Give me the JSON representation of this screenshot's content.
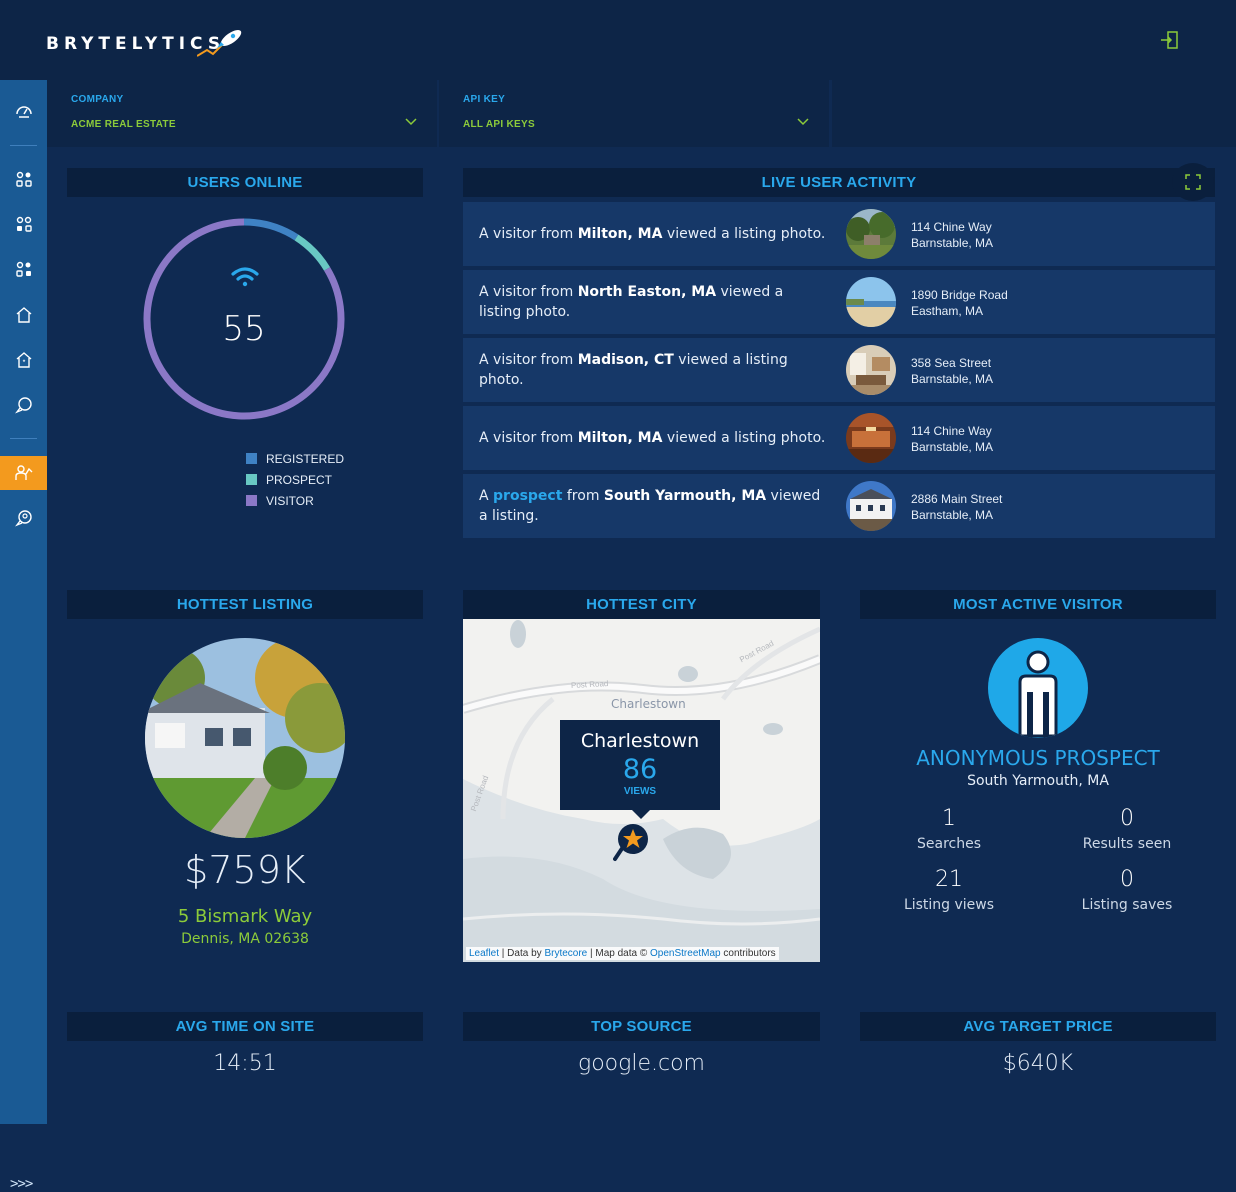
{
  "app": {
    "brand": "BRYTELYTICS"
  },
  "filters": {
    "company": {
      "label": "COMPANY",
      "value": "ACME REAL ESTATE"
    },
    "api_key": {
      "label": "API KEY",
      "value": "ALL API KEYS"
    }
  },
  "users_online": {
    "title": "USERS ONLINE",
    "count": "55",
    "legend": [
      {
        "label": "REGISTERED",
        "color": "#3f82c4"
      },
      {
        "label": "PROSPECT",
        "color": "#68c8c3"
      },
      {
        "label": "VISITOR",
        "color": "#8b78c7"
      }
    ],
    "breakdown": {
      "registered": 5,
      "prospect": 4,
      "visitor": 46
    }
  },
  "live_activity": {
    "title": "LIVE USER ACTIVITY",
    "rows": [
      {
        "pre": "A visitor from ",
        "place": "Milton, MA",
        "post": " viewed a listing photo.",
        "addr1": "114 Chine Way",
        "addr2": "Barnstable, MA"
      },
      {
        "pre": "A visitor from ",
        "place": "North Easton, MA",
        "post": " viewed a listing photo.",
        "addr1": "1890 Bridge Road",
        "addr2": "Eastham, MA"
      },
      {
        "pre": "A visitor from ",
        "place": "Madison, CT",
        "post": " viewed a listing photo.",
        "addr1": "358 Sea Street",
        "addr2": "Barnstable, MA"
      },
      {
        "pre": "A visitor from ",
        "place": "Milton, MA",
        "post": " viewed a listing photo.",
        "addr1": "114 Chine Way",
        "addr2": "Barnstable, MA"
      },
      {
        "pre": "A ",
        "role": "prospect",
        "mid": " from ",
        "place": "South Yarmouth, MA",
        "post": " viewed a listing.",
        "addr1": "2886 Main Street",
        "addr2": "Barnstable, MA"
      }
    ]
  },
  "hottest_listing": {
    "title": "HOTTEST LISTING",
    "price": "$759K",
    "street": "5 Bismark Way",
    "city": "Dennis, MA 02638"
  },
  "hottest_city": {
    "title": "HOTTEST CITY",
    "city": "Charlestown",
    "views": "86",
    "views_label": "VIEWS",
    "map_label": "Charlestown",
    "roads": [
      "Post Road",
      "Post Road",
      "Post Road"
    ],
    "attribution": {
      "leaflet": "Leaflet",
      "data_by": " | Data by ",
      "brytecore": "Brytecore",
      "map_data": " | Map data © ",
      "osm": "OpenStreetMap",
      "contrib": " contributors"
    }
  },
  "most_active_visitor": {
    "title": "MOST ACTIVE VISITOR",
    "name": "ANONYMOUS PROSPECT",
    "location": "South Yarmouth, MA",
    "stats": [
      {
        "value": "1",
        "label": "Searches"
      },
      {
        "value": "0",
        "label": "Results seen"
      },
      {
        "value": "21",
        "label": "Listing views"
      },
      {
        "value": "0",
        "label": "Listing saves"
      }
    ]
  },
  "kpis": [
    {
      "title": "AVG TIME ON SITE",
      "value": "14:51"
    },
    {
      "title": "TOP SOURCE",
      "value": "google.com"
    },
    {
      "title": "AVG TARGET PRICE",
      "value": "$640K"
    }
  ],
  "colors": {
    "accent": "#2aa8ec",
    "green": "#8ccb3a",
    "orange": "#f39a1e",
    "bg": "#0f2a52",
    "header": "#0a1f3d"
  },
  "sidebar": {
    "icons": [
      "dashboard-icon",
      "apps-icon-1",
      "apps-icon-2",
      "apps-icon-3",
      "home-icon",
      "home-star-icon",
      "chat-icon",
      "user-activity-icon",
      "live-chat-icon"
    ],
    "active": "user-activity-icon",
    "expand": ">>>"
  }
}
